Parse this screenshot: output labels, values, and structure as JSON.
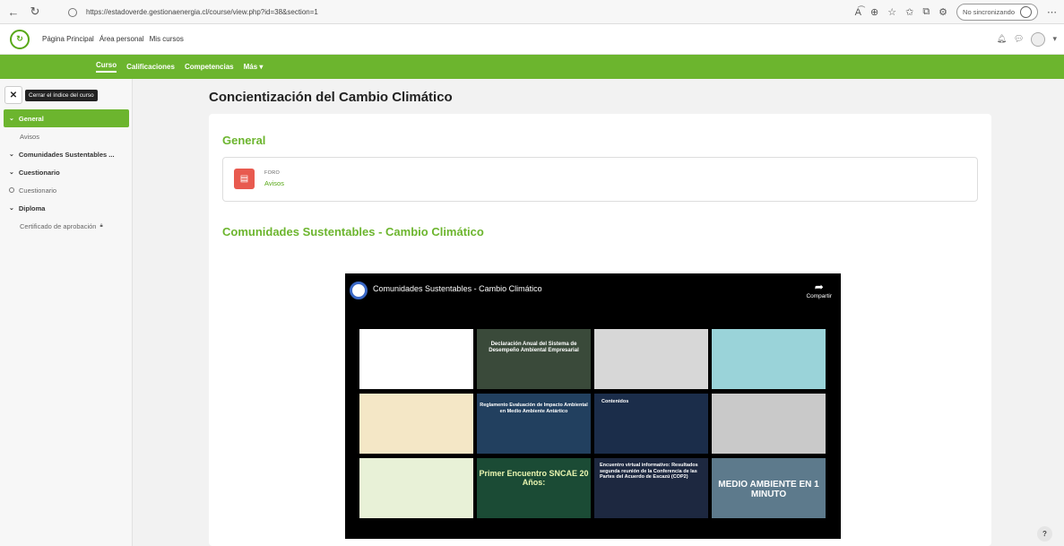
{
  "browser": {
    "url": "https://estadoverde.gestionaenergia.cl/course/view.php?id=38&section=1",
    "sync_label": "No sincronizando"
  },
  "topbar": {
    "nav": [
      "Página Principal",
      "Área personal",
      "Mis cursos"
    ]
  },
  "secondary_nav": {
    "items": [
      "Curso",
      "Calificaciones",
      "Competencias",
      "Más ▾"
    ],
    "active_index": 0
  },
  "drawer": {
    "close_tooltip": "Cerrar el índice del curso",
    "items": [
      {
        "label": "General",
        "kind": "section",
        "active": true
      },
      {
        "label": "Avisos",
        "kind": "sub"
      },
      {
        "label": "Comunidades Sustentables ...",
        "kind": "section"
      },
      {
        "label": "Cuestionario",
        "kind": "section"
      },
      {
        "label": "Cuestionario",
        "kind": "activity"
      },
      {
        "label": "Diploma",
        "kind": "section"
      },
      {
        "label": "Certificado de aprobación",
        "kind": "sub",
        "locked": true
      }
    ]
  },
  "main": {
    "course_title": "Concientización del Cambio Climático",
    "section_general": "General",
    "activity_type": "FORO",
    "activity_name": "Avisos",
    "section_2": "Comunidades Sustentables - Cambio Climático"
  },
  "video": {
    "title": "Comunidades Sustentables - Cambio Climático",
    "share_label": "Compartir",
    "tiles": [
      {
        "caption": ""
      },
      {
        "caption": "Declaración Anual del Sistema de Desempeño Ambiental Empresarial"
      },
      {
        "caption": ""
      },
      {
        "caption": ""
      },
      {
        "caption": ""
      },
      {
        "caption": "Reglamento Evaluación de Impacto Ambiental en Medio Ambiente Antártico"
      },
      {
        "caption": "Contenidos"
      },
      {
        "caption": ""
      },
      {
        "caption": ""
      },
      {
        "caption": "Primer Encuentro SNCAE 20 Años:"
      },
      {
        "caption": "Encuentro virtual informativo: Resultados segunda reunión de la Conferencia de las Partes del Acuerdo de Escazú (COP2)"
      },
      {
        "caption": "MEDIO AMBIENTE EN 1 MINUTO"
      }
    ]
  },
  "help_label": "?"
}
